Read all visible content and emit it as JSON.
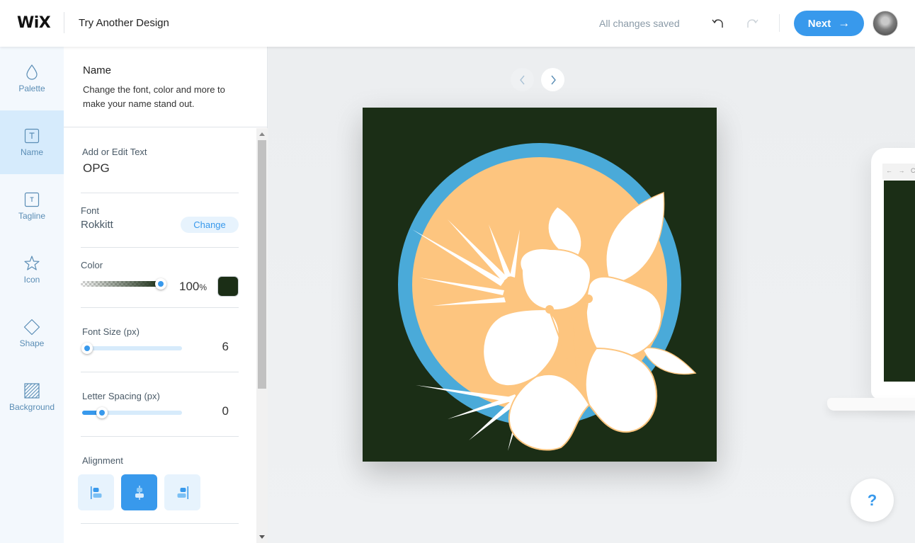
{
  "header": {
    "logo": "WiX",
    "title": "Try Another Design",
    "status": "All changes saved",
    "next_label": "Next",
    "next_arrow": "→"
  },
  "rail": {
    "items": [
      {
        "label": "Palette",
        "icon": "drop-icon",
        "active": false
      },
      {
        "label": "Name",
        "icon": "text-box-icon",
        "active": true
      },
      {
        "label": "Tagline",
        "icon": "text-box-small-icon",
        "active": false
      },
      {
        "label": "Icon",
        "icon": "star-icon",
        "active": false
      },
      {
        "label": "Shape",
        "icon": "diamond-icon",
        "active": false
      },
      {
        "label": "Background",
        "icon": "hatched-square-icon",
        "active": false
      }
    ]
  },
  "panel": {
    "title": "Name",
    "description": "Change the font, color and more to make your name stand out.",
    "text_section": {
      "label": "Add or Edit Text",
      "value": "OPG"
    },
    "font_section": {
      "label": "Font",
      "value": "Rokkitt",
      "change_label": "Change"
    },
    "color_section": {
      "label": "Color",
      "opacity_value": "100",
      "opacity_unit": "%",
      "opacity_fraction": 1.0,
      "color_hex": "#1b2e16"
    },
    "font_size_section": {
      "label": "Font Size (px)",
      "value": "6",
      "slider_fraction": 0.05
    },
    "letter_spacing_section": {
      "label": "Letter Spacing (px)",
      "value": "0",
      "slider_fraction": 0.2
    },
    "alignment_section": {
      "label": "Alignment",
      "options": [
        "left",
        "center",
        "right"
      ],
      "selected": "center"
    }
  },
  "stage": {
    "preview_colors": {
      "background": "#1b2e16",
      "ring": "#4aaad9",
      "sun": "#fdc57f",
      "flower": "#ffffff"
    },
    "laptop_nav": "← → C",
    "help_label": "?"
  },
  "colors": {
    "accent": "#3899ec",
    "rail_active": "#d6ebfc"
  }
}
